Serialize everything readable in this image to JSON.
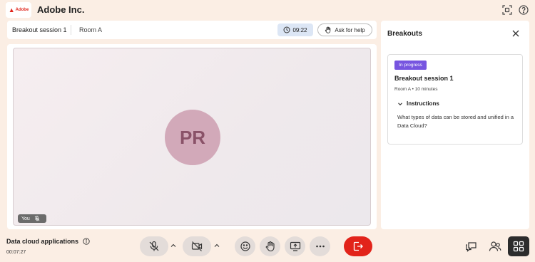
{
  "header": {
    "logo_text": "Adobe",
    "org_name": "Adobe Inc."
  },
  "session_bar": {
    "title": "Breakout session 1",
    "room": "Room A",
    "timer": "09:22",
    "help_label": "Ask for help"
  },
  "video": {
    "initials": "PR",
    "self_label": "You"
  },
  "breakouts_panel": {
    "title": "Breakouts",
    "card": {
      "status": "In progress",
      "title": "Breakout session 1",
      "subtitle": "Room A • 10 minutes",
      "instructions_label": "Instructions",
      "instructions_text": "What types of data can be stored and unified in a Data Cloud?"
    }
  },
  "footer": {
    "meeting_title": "Data cloud applications",
    "elapsed": "00:07:27"
  },
  "colors": {
    "background": "#fbeee4",
    "badge": "#7755e0",
    "leave": "#e2231a",
    "avatar": "#d2a9b9"
  },
  "icons": [
    "adobe-logo",
    "fullscreen-icon",
    "help-circle-icon",
    "clock-icon",
    "raise-hand-icon",
    "mic-off-icon",
    "camera-off-icon",
    "emoji-icon",
    "share-screen-icon",
    "more-icon",
    "leave-icon",
    "chat-icon",
    "people-icon",
    "grid-icon",
    "close-icon",
    "chevron-down-icon"
  ]
}
